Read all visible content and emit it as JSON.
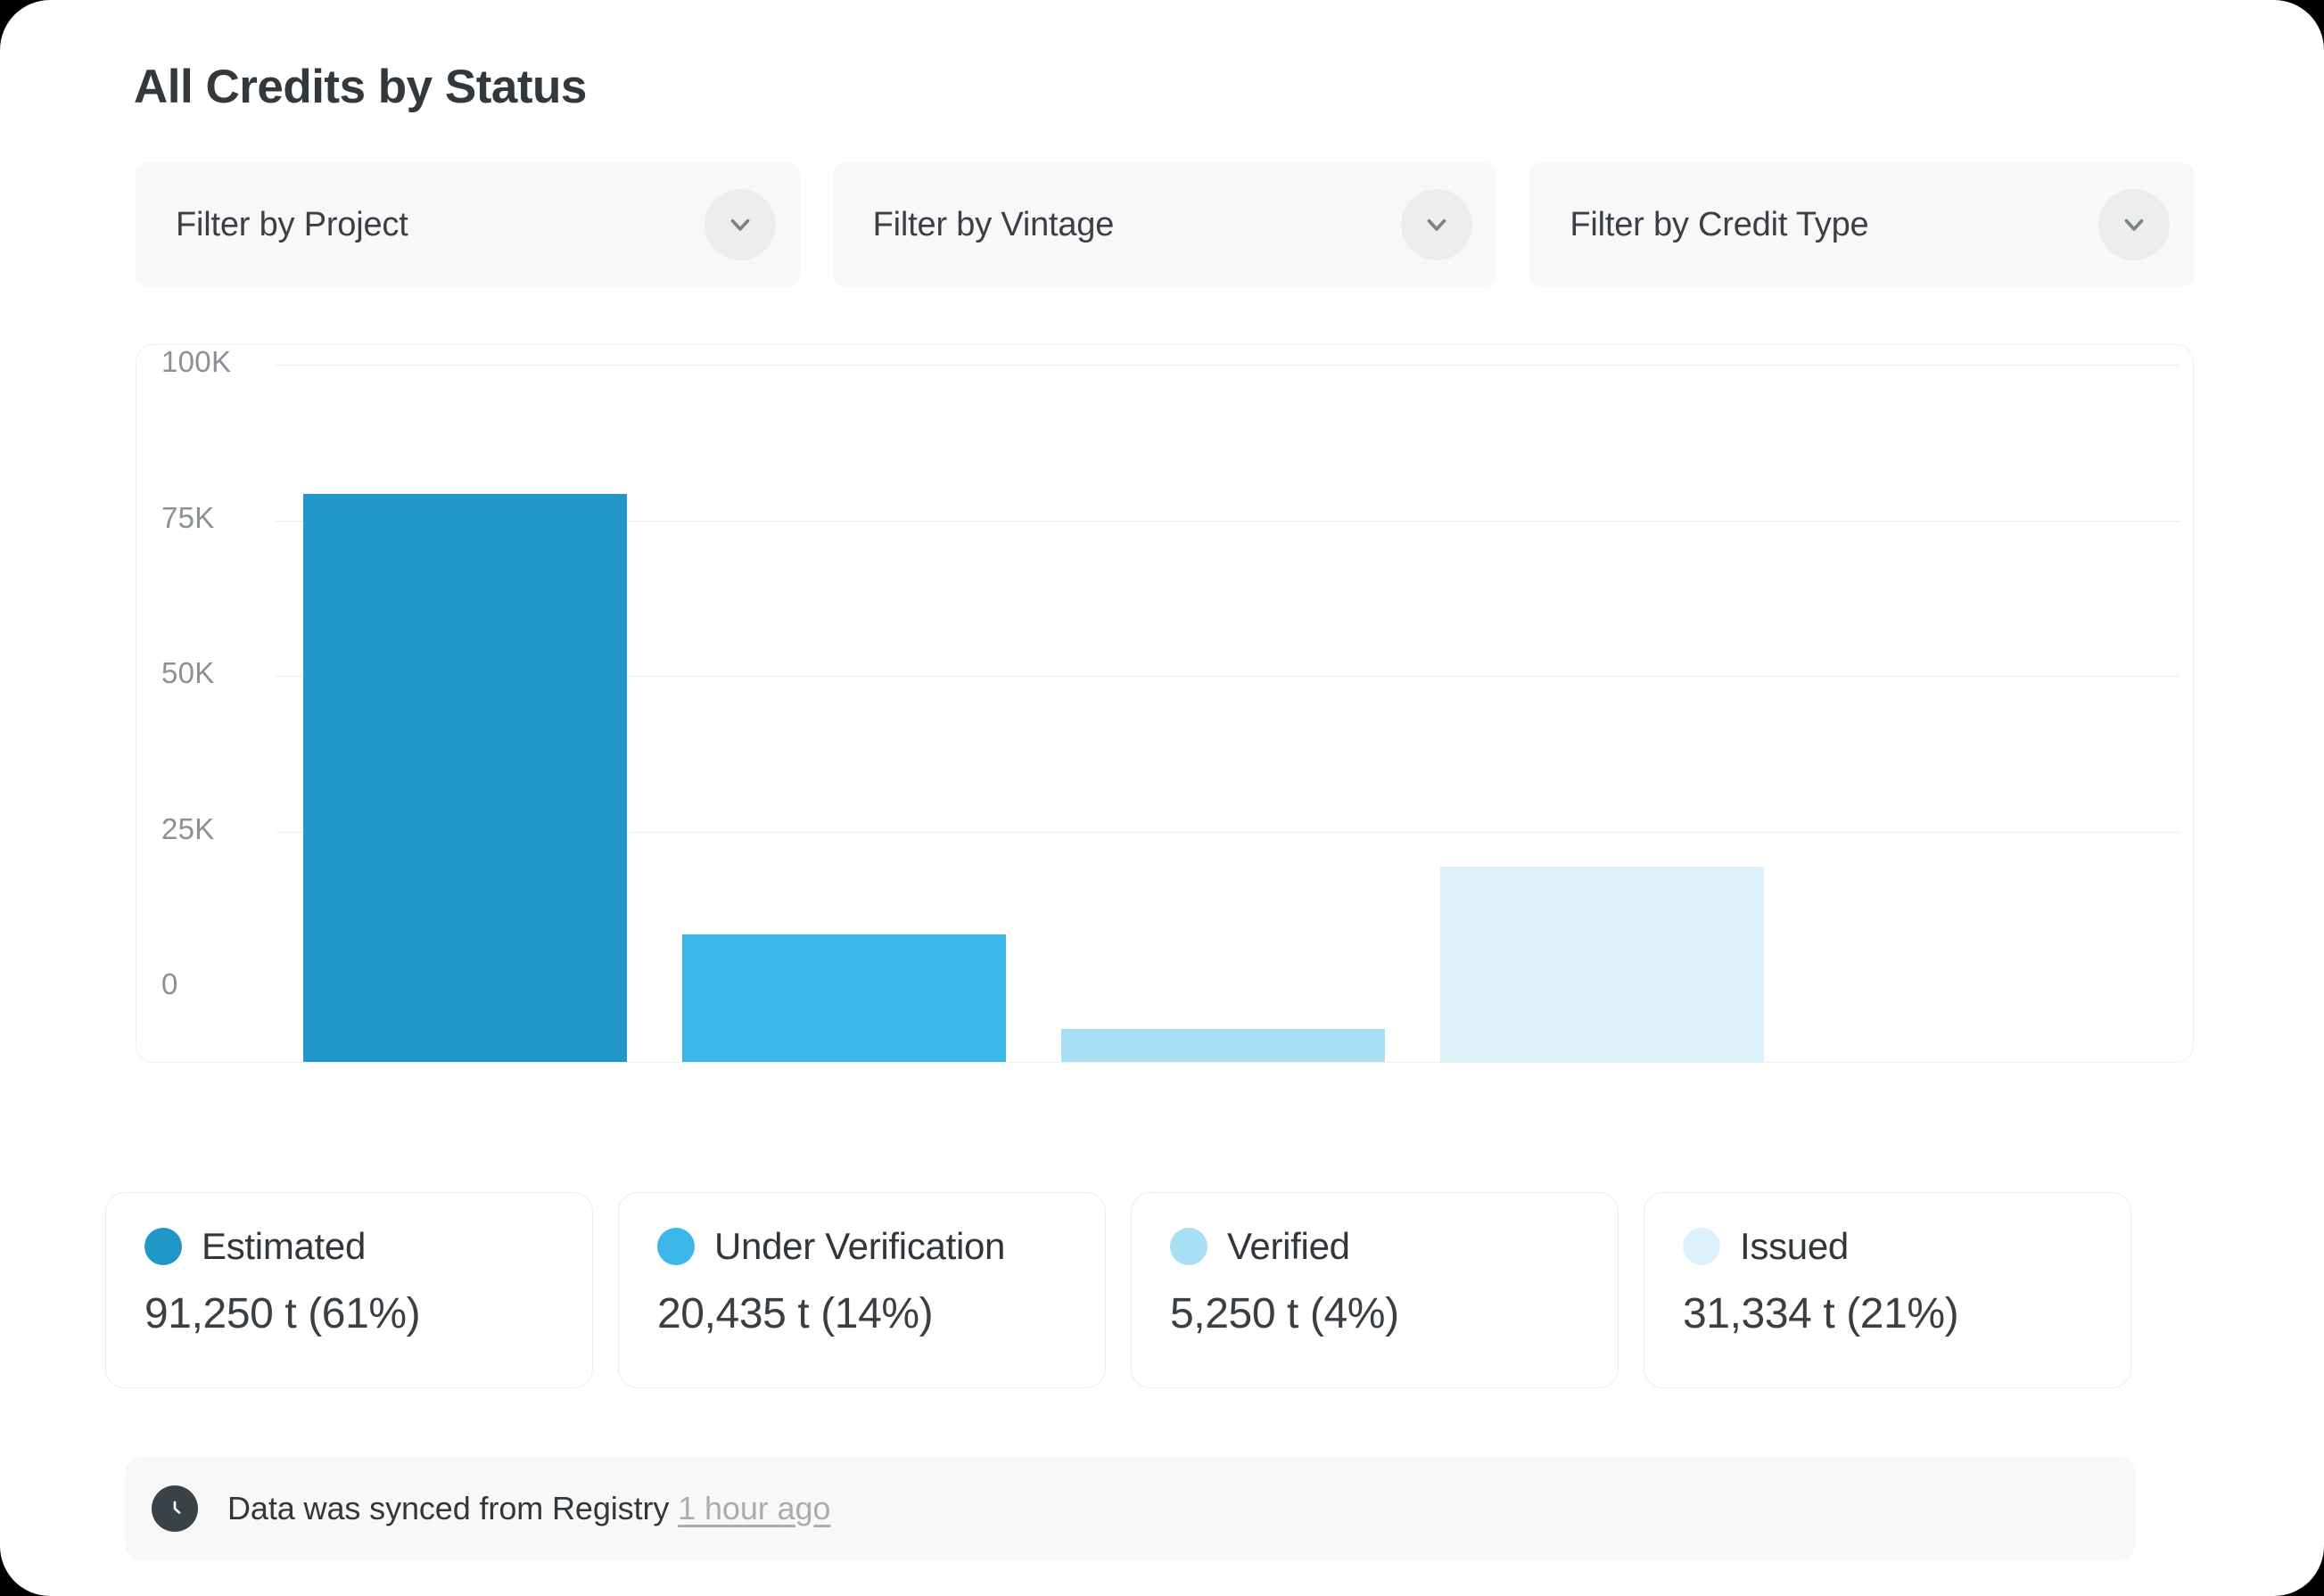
{
  "page": {
    "title": "All Credits by Status"
  },
  "filters": [
    {
      "label": "Filter by Project",
      "icon": "chevron-down-icon",
      "name": "project"
    },
    {
      "label": "Filter by Vintage",
      "icon": "chevron-down-icon",
      "name": "vintage"
    },
    {
      "label": "Filter by Credit Type",
      "icon": "chevron-down-icon",
      "name": "credit-type"
    }
  ],
  "chart_data": {
    "type": "bar",
    "title": "All Credits by Status",
    "xlabel": "",
    "ylabel": "",
    "categories": [
      "Estimated",
      "Under Verification",
      "Verified",
      "Issued"
    ],
    "values": [
      91250,
      20435,
      5250,
      31334
    ],
    "ylim": [
      0,
      100000
    ],
    "yticks": [
      0,
      25000,
      50000,
      75000,
      100000
    ],
    "ytick_labels": [
      "0",
      "25K",
      "50K",
      "75K",
      "100K"
    ],
    "grid": true,
    "legend_position": "bottom",
    "colors": [
      "#2096c9",
      "#3bb7e9",
      "#a9dff5",
      "#ddf1fa"
    ],
    "bar_percent_of_width": 0.795
  },
  "legend": [
    {
      "label": "Estimated",
      "value": "91,250 t (61%)",
      "color": "#2096c9"
    },
    {
      "label": "Under Verification",
      "value": "20,435 t (14%)",
      "color": "#3bb7e9"
    },
    {
      "label": "Verified",
      "value": "5,250 t (4%)",
      "color": "#a9dff5"
    },
    {
      "label": "Issued",
      "value": "31,334 t (21%)",
      "color": "#ddf1fa"
    }
  ],
  "sync": {
    "icon": "clock-icon",
    "text": "Data was synced from Registry",
    "link": "1 hour ago"
  }
}
